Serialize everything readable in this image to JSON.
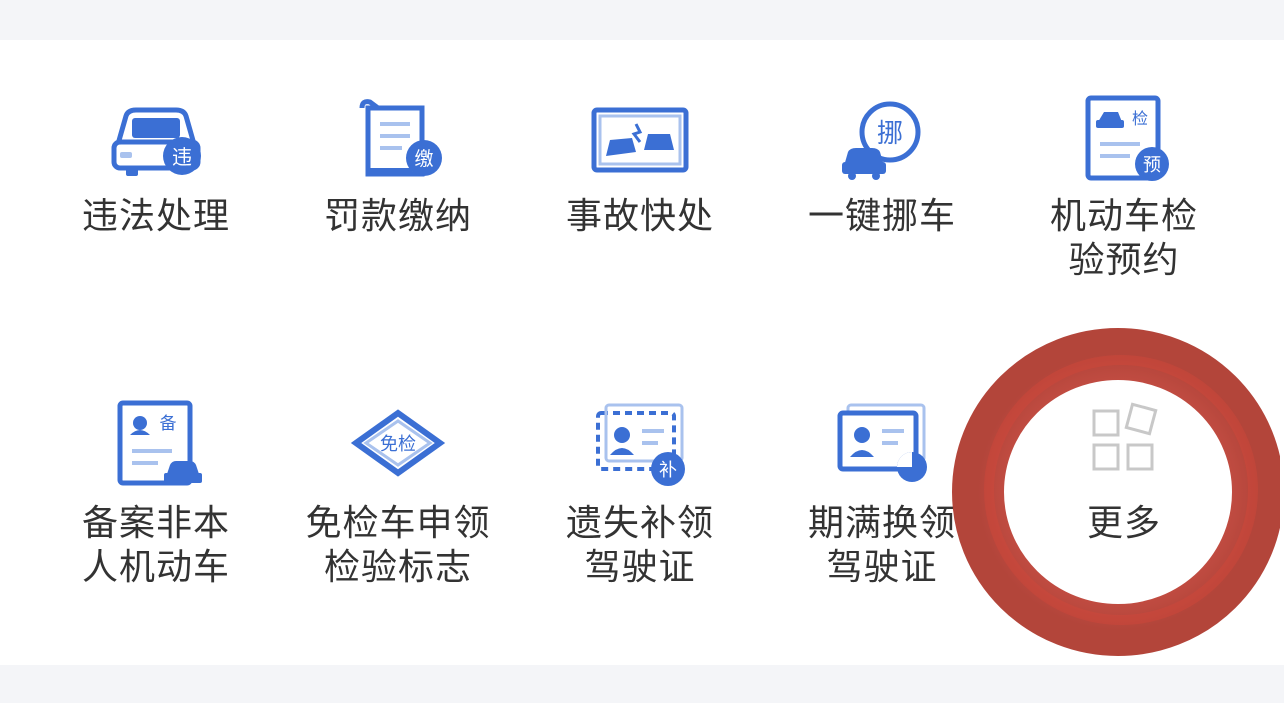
{
  "services": [
    {
      "label": "违法处理",
      "badge": "违"
    },
    {
      "label": "罚款缴纳",
      "badge": "缴"
    },
    {
      "label": "事故快处",
      "badge": ""
    },
    {
      "label": "一键挪车",
      "badge": "挪"
    },
    {
      "label": "机动车检\n验预约",
      "badge": "预",
      "tag": "检"
    },
    {
      "label": "备案非本\n人机动车",
      "badge": "",
      "tag": "备"
    },
    {
      "label": "免检车申领\n检验标志",
      "badge": "免检"
    },
    {
      "label": "遗失补领\n驾驶证",
      "badge": "补"
    },
    {
      "label": "期满换领\n驾驶证",
      "badge": ""
    },
    {
      "label": "更多",
      "badge": ""
    }
  ],
  "colors": {
    "accent": "#3b6fd4",
    "accent_light": "#a9c2ee",
    "text": "#333333",
    "more_icon": "#c8c8c8",
    "annotation": "#c0362a"
  }
}
